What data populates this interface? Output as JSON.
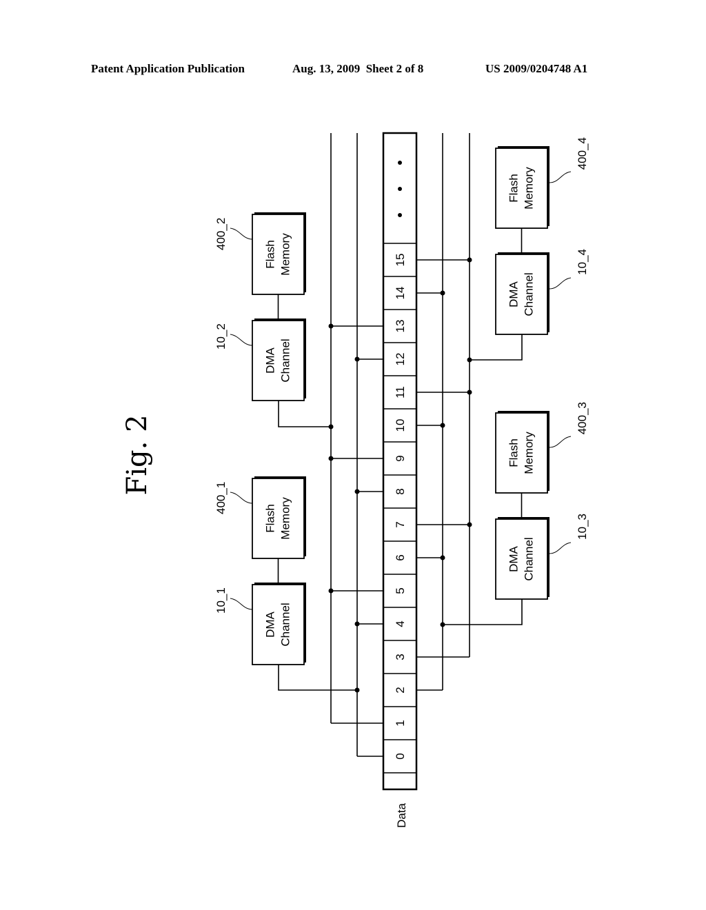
{
  "header": {
    "publication": "Patent Application Publication",
    "date_sheet": "Aug. 13, 2009  Sheet 2 of 8",
    "number": "US 2009/0204748 A1"
  },
  "figure": {
    "title": "Fig. 2",
    "data_label": "Data",
    "ellipsis": "• • •",
    "slots": [
      "0",
      "1",
      "2",
      "3",
      "4",
      "5",
      "6",
      "7",
      "8",
      "9",
      "10",
      "11",
      "12",
      "13",
      "14",
      "15"
    ],
    "buses": [
      {
        "id": "A",
        "slots": [
          1,
          5,
          9,
          13
        ],
        "dma": "10_2"
      },
      {
        "id": "B",
        "slots": [
          0,
          4,
          8,
          12
        ],
        "dma": "10_1"
      },
      {
        "id": "C",
        "slots": [
          2,
          6,
          10,
          14
        ],
        "dma": "10_3"
      },
      {
        "id": "D",
        "slots": [
          3,
          7,
          11,
          15
        ],
        "dma": "10_4"
      }
    ],
    "channels": [
      {
        "dma_ref": "10_1",
        "dma_line1": "DMA",
        "dma_line2": "Channel",
        "mem_ref": "400_1",
        "mem_line1": "Flash",
        "mem_line2": "Memory"
      },
      {
        "dma_ref": "10_2",
        "dma_line1": "DMA",
        "dma_line2": "Channel",
        "mem_ref": "400_2",
        "mem_line1": "Flash",
        "mem_line2": "Memory"
      },
      {
        "dma_ref": "10_3",
        "dma_line1": "DMA",
        "dma_line2": "Channel",
        "mem_ref": "400_3",
        "mem_line1": "Flash",
        "mem_line2": "Memory"
      },
      {
        "dma_ref": "10_4",
        "dma_line1": "DMA",
        "dma_line2": "Channel",
        "mem_ref": "400_4",
        "mem_line1": "Flash",
        "mem_line2": "Memory"
      }
    ]
  }
}
